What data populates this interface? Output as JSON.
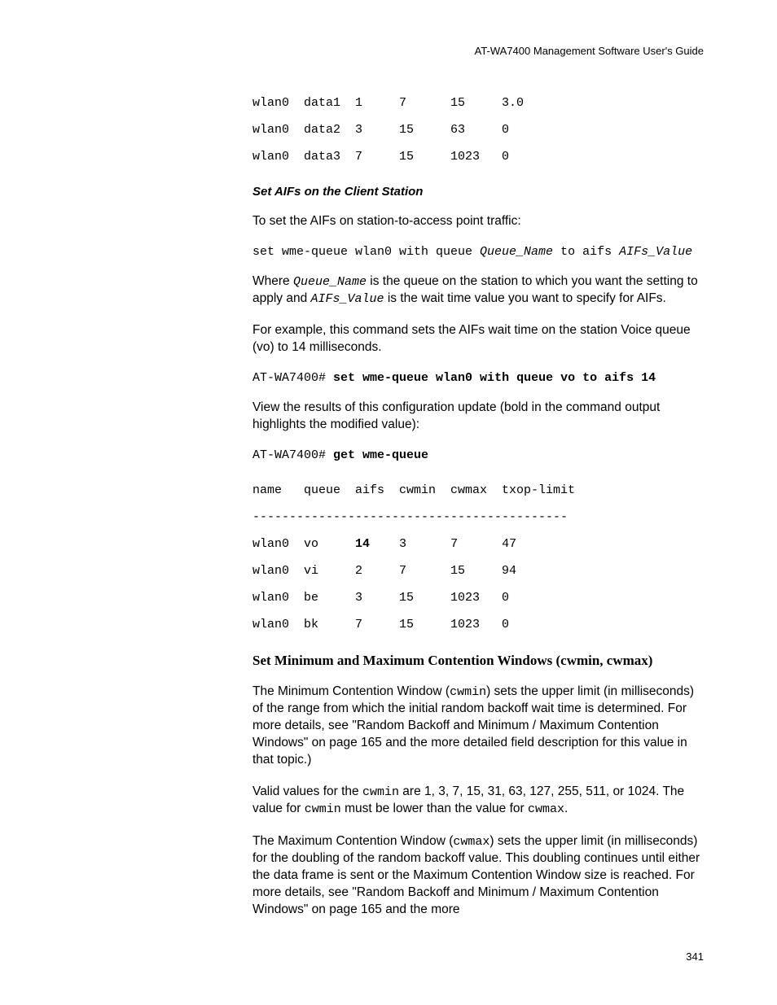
{
  "header": "AT-WA7400 Management Software User's Guide",
  "pageNumber": "341",
  "topTable": {
    "r1": "wlan0  data1  1     7      15     3.0",
    "r2": "wlan0  data2  3     15     63     0",
    "r3": "wlan0  data3  7     15     1023   0"
  },
  "heading1": "Set AIFs on the Client Station",
  "p1": "To set the AIFs on station-to-access point traffic:",
  "syntax": {
    "pre": "set wme-queue wlan0 with queue ",
    "q": "Queue_Name",
    "mid": " to aifs ",
    "v": "AIFs_Value"
  },
  "p2a": "Where ",
  "p2b": "Queue_Name",
  "p2c": " is the queue on the station to which you want the setting to apply and ",
  "p2d": "AIFs_Value",
  "p2e": " is the wait time value you want to specify for AIFs.",
  "p3": "For example, this command sets the AIFs wait time on the station Voice queue (vo) to 14 milliseconds.",
  "cmd1prompt": "AT-WA7400# ",
  "cmd1body": "set wme-queue wlan0 with queue vo to aifs 14",
  "p4": "View the results of this configuration update (bold in the command output highlights the modified value):",
  "cmd2prompt": "AT-WA7400# ",
  "cmd2body": "get wme-queue",
  "out": {
    "hdr": "name   queue  aifs  cwmin  cwmax  txop-limit",
    "sep": "-------------------------------------------",
    "r1a": "wlan0  vo     ",
    "r1bold": "14",
    "r1b": "    3      7      47",
    "r2": "wlan0  vi     2     7      15     94",
    "r3": "wlan0  be     3     15     1023   0",
    "r4": "wlan0  bk     7     15     1023   0"
  },
  "heading2": "Set Minimum and Maximum Contention Windows (cwmin, cwmax)",
  "p5a": "The Minimum Contention Window (",
  "p5b": "cwmin",
  "p5c": ") sets the upper limit (in milliseconds) of the range from which the initial random backoff wait time is determined. For more details, see \"Random Backoff and Minimum / Maximum Contention Windows\" on page 165 and the more detailed field description for this value in that topic.)",
  "p6a": "Valid values for the ",
  "p6b": "cwmin",
  "p6c": " are 1, 3, 7, 15, 31, 63, 127, 255, 511, or 1024. The value for ",
  "p6d": "cwmin",
  "p6e": " must be lower than the value for ",
  "p6f": "cwmax",
  "p6g": ".",
  "p7a": "The Maximum Contention Window (",
  "p7b": "cwmax",
  "p7c": ") sets the upper limit (in milliseconds) for the doubling of the random backoff value. This doubling continues until either the data frame is sent or the Maximum Contention Window size is reached. For more details, see \"Random Backoff and Minimum / Maximum Contention Windows\" on page 165 and the more"
}
